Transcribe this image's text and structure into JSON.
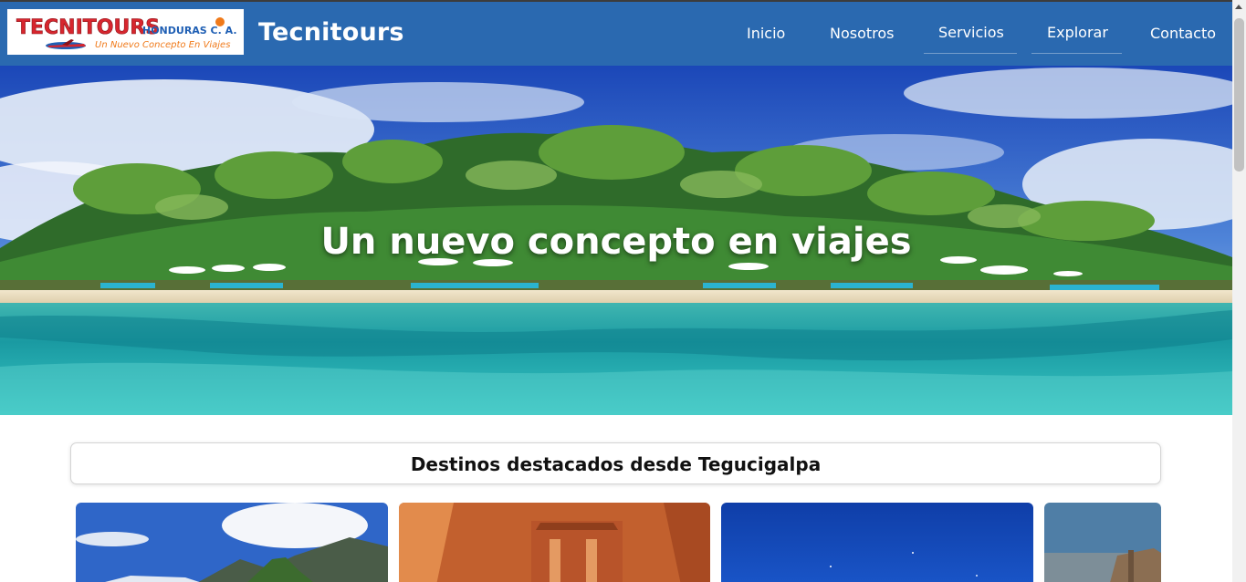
{
  "header": {
    "logo": {
      "main_text": "TECNITOURS",
      "sub_text": "HONDURAS C. A.",
      "tagline": "Un Nuevo Concepto En Viajes",
      "icon": "airplane-logo-icon"
    },
    "brand": "Tecnitours",
    "nav": [
      {
        "label": "Inicio"
      },
      {
        "label": "Nosotros"
      },
      {
        "label": "Servicios"
      },
      {
        "label": "Explorar"
      },
      {
        "label": "Contacto"
      }
    ]
  },
  "hero": {
    "title": "Un nuevo concepto en viajes"
  },
  "featured": {
    "title": "Destinos destacados desde Tegucigalpa"
  },
  "colors": {
    "navbar": "#2a69b0",
    "text_light": "#ffffff",
    "logo_red": "#d7262e",
    "logo_blue": "#1f5fb4",
    "logo_orange": "#f07a1a"
  }
}
